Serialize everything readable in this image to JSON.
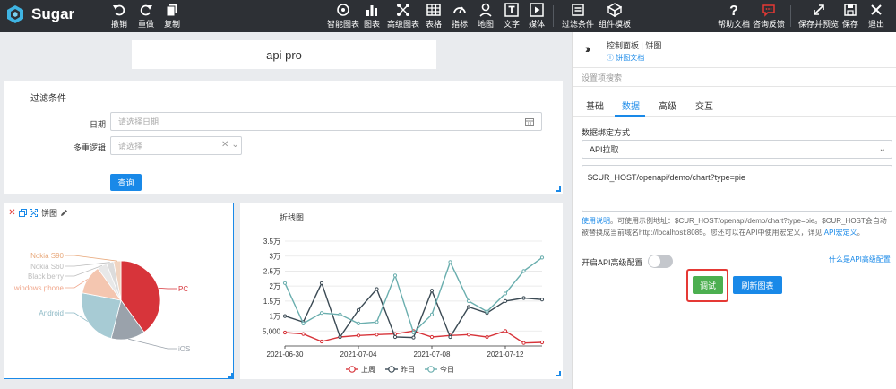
{
  "app": {
    "name": "Sugar"
  },
  "toolbar": {
    "undo": "撤销",
    "redo": "重做",
    "copy": "复制",
    "smart_chart": "智能图表",
    "chart": "图表",
    "advanced_chart": "高级图表",
    "table": "表格",
    "indicator": "指标",
    "map": "地图",
    "text": "文字",
    "media": "媒体",
    "filter": "过滤条件",
    "component_template": "组件模板",
    "help_doc": "帮助文档",
    "feedback": "咨询反馈",
    "save_preview": "保存并预览",
    "save": "保存",
    "exit": "退出"
  },
  "canvas": {
    "title": "api pro",
    "filter_card": {
      "title": "过滤条件",
      "date_label": "日期",
      "date_placeholder": "请选择日期",
      "multi_label": "多重逻辑",
      "multi_placeholder": "请选择",
      "query_button": "查询"
    },
    "pie_card": {
      "title": "饼图"
    },
    "line_card": {
      "title": "折线图"
    }
  },
  "chart_data": [
    {
      "type": "pie",
      "title": "",
      "categories": [
        "PC",
        "iOS",
        "Android",
        "windows phone",
        "Black berry",
        "Nokia S60",
        "Nokia S90"
      ],
      "values": [
        40,
        14,
        24,
        12,
        4,
        3,
        3
      ],
      "colors": [
        "#d7343a",
        "#9aa2ab",
        "#a7cbd4",
        "#f4c6b0",
        "#e8e8e8",
        "#dcdcdc",
        "#f1d4c0"
      ],
      "label_colors": [
        "#d7343a",
        "#9aa2ab",
        "#8fbac6",
        "#f0a68b",
        "#bdbdbd",
        "#bdbdbd",
        "#e8a97c"
      ]
    },
    {
      "type": "line",
      "title": "",
      "x": [
        "2021-06-30",
        "2021-07-01",
        "2021-07-02",
        "2021-07-03",
        "2021-07-04",
        "2021-07-05",
        "2021-07-06",
        "2021-07-07",
        "2021-07-08",
        "2021-07-09",
        "2021-07-10",
        "2021-07-11",
        "2021-07-12",
        "2021-07-13",
        "2021-07-14"
      ],
      "x_tick_labels": [
        "2021-06-30",
        "2021-07-04",
        "2021-07-08",
        "2021-07-12"
      ],
      "y_tick_labels": [
        "5,000",
        "1万",
        "1.5万",
        "2万",
        "2.5万",
        "3万",
        "3.5万"
      ],
      "ylim": [
        0,
        35000
      ],
      "grid": true,
      "legend_position": "bottom",
      "series": [
        {
          "name": "上周",
          "color": "#d7343a",
          "values": [
            4500,
            4000,
            1500,
            3000,
            3500,
            3800,
            4000,
            5000,
            3000,
            3500,
            3800,
            3000,
            5000,
            1000,
            1200
          ]
        },
        {
          "name": "昨日",
          "color": "#3b4a54",
          "values": [
            10000,
            8000,
            21000,
            3000,
            12000,
            19000,
            3000,
            2800,
            18500,
            3000,
            13000,
            11000,
            15000,
            16000,
            15500
          ]
        },
        {
          "name": "今日",
          "color": "#6aaeae",
          "values": [
            21000,
            7500,
            11000,
            10500,
            7500,
            8000,
            23500,
            4500,
            10500,
            28000,
            15000,
            11500,
            17500,
            25000,
            29500
          ]
        }
      ]
    }
  ],
  "panel": {
    "breadcrumb": "控制面板 | 饼图",
    "doc_link": "饼图文档",
    "search_placeholder": "设置项搜索",
    "tabs": [
      "基础",
      "数据",
      "高级",
      "交互"
    ],
    "binding_label": "数据绑定方式",
    "binding_value": "API拉取",
    "api_url": "$CUR_HOST/openapi/demo/chart?type=pie",
    "help": {
      "link1": "使用说明",
      "text": "。可使用示例地址：$CUR_HOST/openapi/demo/chart?type=pie。$CUR_HOST会自动被替换成当前域名http://localhost:8085。您还可以在API中使用宏定义，详见 ",
      "link2": "API宏定义",
      "end": "。"
    },
    "advanced_toggle_label": "开启API高级配置",
    "advanced_link": "什么是API高级配置",
    "debug_button": "调试",
    "refresh_button": "刷新图表"
  }
}
